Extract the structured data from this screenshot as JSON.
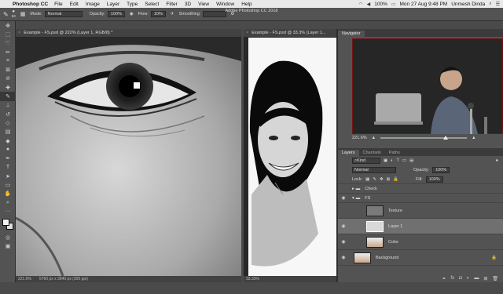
{
  "menubar": {
    "app": "Photoshop CC",
    "items": [
      "File",
      "Edit",
      "Image",
      "Layer",
      "Type",
      "Select",
      "Filter",
      "3D",
      "View",
      "Window",
      "Help"
    ],
    "battery": "100%",
    "datetime": "Mon 27 Aug 9:48 PM",
    "user": "Unmesh Dinda"
  },
  "window_title": "Adobe Photoshop CC 2018",
  "options": {
    "brush_size": "83",
    "mode_label": "Mode:",
    "mode_value": "Normal",
    "opacity_label": "Opacity:",
    "opacity_value": "100%",
    "flow_label": "Flow:",
    "flow_value": "10%",
    "smoothing_label": "Smoothing:"
  },
  "doc1": {
    "tab": "Example - FS.psd @ 222% (Layer 1, RGB/8) *",
    "zoom": "221.6%",
    "size": "5760 px x 3840 px (300 ppi)"
  },
  "doc2": {
    "tab": "Example - FS.psd @ 33.3% (Layer 1...",
    "zoom": "33.33%"
  },
  "navigator": {
    "tab": "Navigator",
    "zoom": "221.6%"
  },
  "layers": {
    "tabs": [
      "Layers",
      "Channels",
      "Paths"
    ],
    "kind": "Kind",
    "blend": "Normal",
    "opacity_label": "Opacity:",
    "opacity_value": "100%",
    "lock_label": "Lock:",
    "fill_label": "Fill:",
    "fill_value": "100%",
    "rows": [
      {
        "name": "Check"
      },
      {
        "name": "FS"
      },
      {
        "name": "Texture"
      },
      {
        "name": "Layer 1"
      },
      {
        "name": "Color"
      },
      {
        "name": "Background"
      }
    ]
  },
  "colors": {
    "panel": "#535353",
    "selected_layer": "#707070"
  }
}
